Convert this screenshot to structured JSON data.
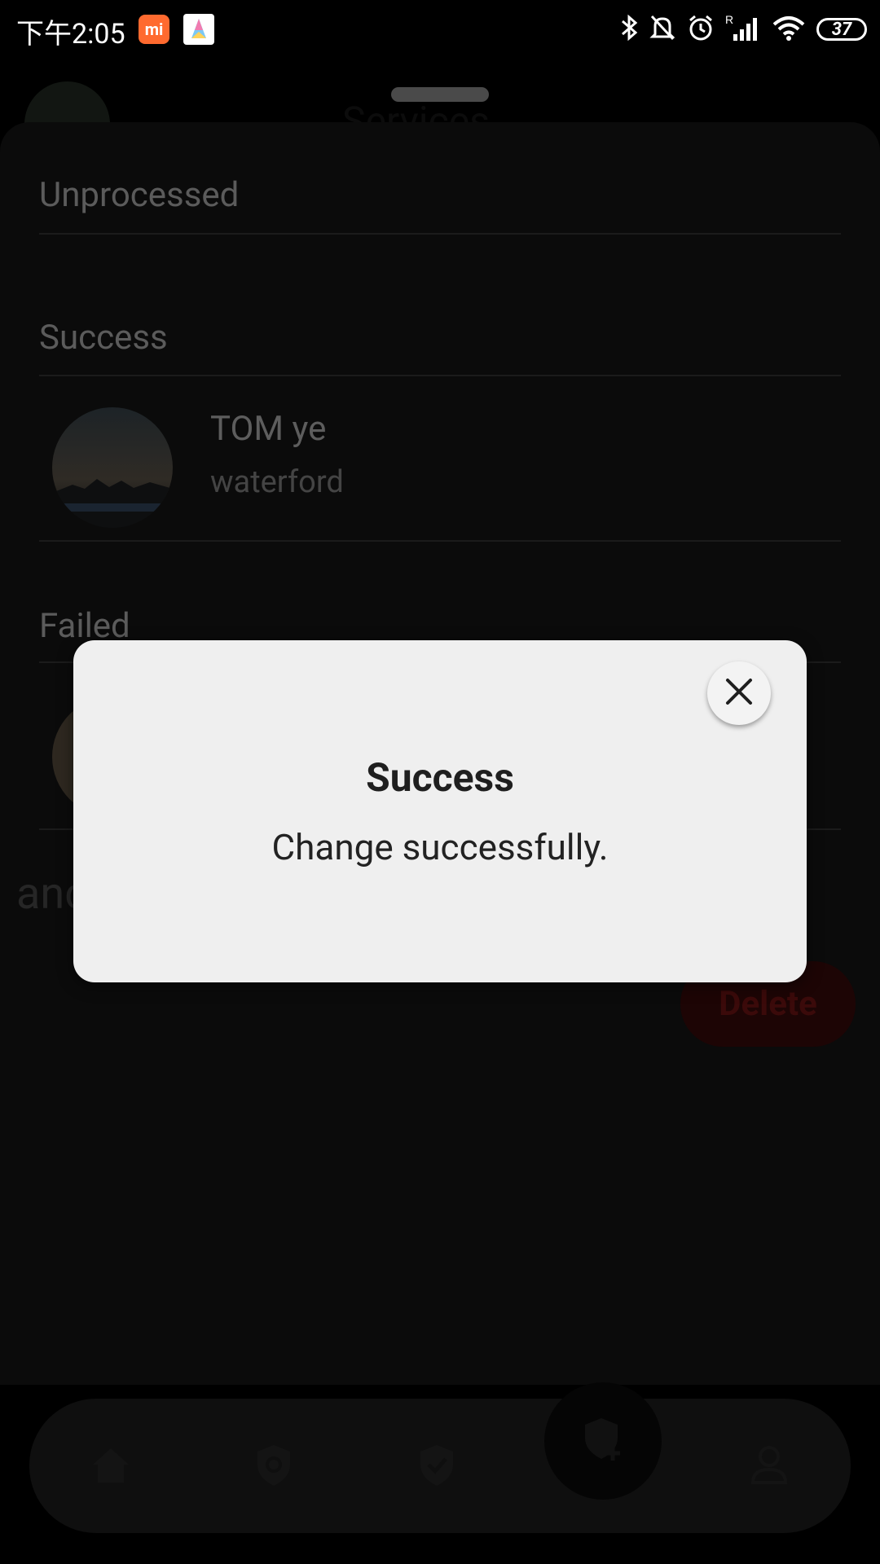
{
  "status_bar": {
    "time": "下午2:05",
    "mi_badge": "mi",
    "battery": "37"
  },
  "background": {
    "header_title": "Services",
    "sections": {
      "unprocessed": "Unprocessed",
      "success": "Success",
      "failed": "Failed"
    },
    "success_item": {
      "name": "TOM ye",
      "location": "waterford"
    },
    "partial_text": "anc",
    "delete_label": "Delete"
  },
  "bottom_nav": {
    "items": [
      "home-icon",
      "shield-search-icon",
      "shield-check-icon",
      "shield-add-icon",
      "person-icon"
    ]
  },
  "modal": {
    "title": "Success",
    "message": "Change successfully."
  },
  "colors": {
    "modal_bg": "#efefef",
    "overlay": "#000000",
    "delete_red": "#3b0a0a"
  }
}
